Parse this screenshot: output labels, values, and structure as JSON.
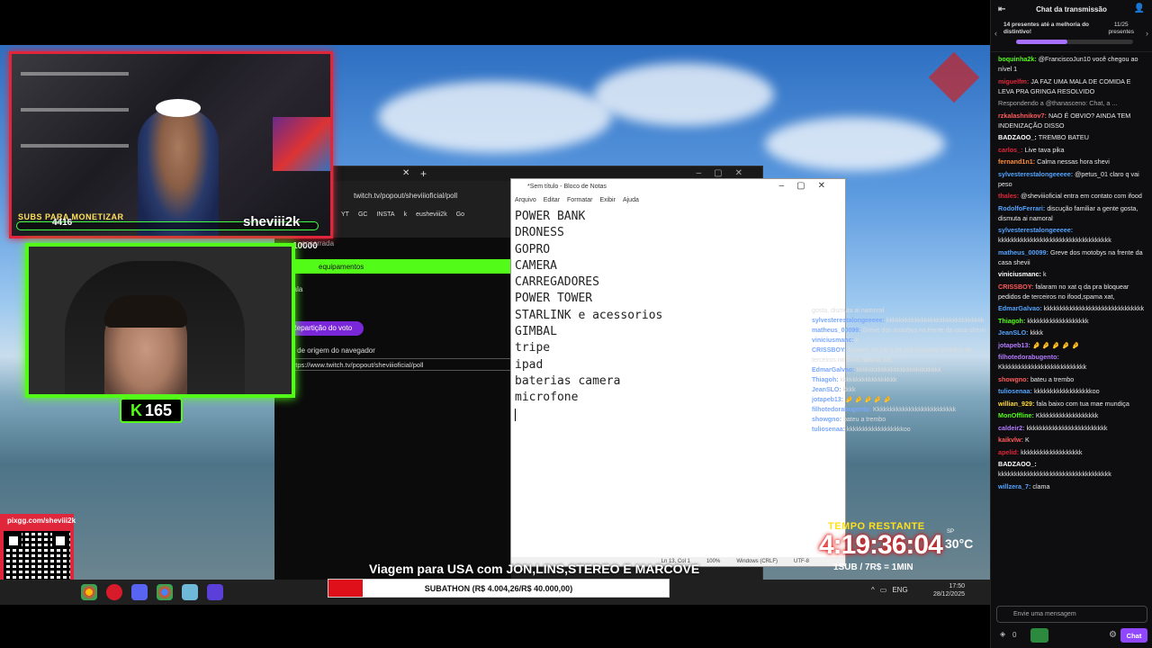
{
  "webcam_overlay": {
    "subs_label": "SUBS PARA MONETIZAR",
    "subs_count": "4416",
    "brand": "sheviii2k",
    "kick_followers": "165"
  },
  "browser": {
    "url": "twitch.tv/popout/sheviiioficial/poll",
    "bookmarks": [
      "YT",
      "GC",
      "INSTA",
      "k",
      "eusheviii2k",
      "Go"
    ],
    "poll_total": "10000",
    "poll_sub": "encerrada",
    "poll_option": "equipamentos",
    "poll_option2": "mala",
    "poll_button": "Repartição do voto",
    "origin_label": "RL de origem do navegador",
    "origin_url": "https://www.twitch.tv/popout/sheviiioficial/poll"
  },
  "notepad": {
    "title": "*Sem título - Bloco de Notas",
    "menu": [
      "Arquivo",
      "Editar",
      "Formatar",
      "Exibir",
      "Ajuda"
    ],
    "lines": [
      "POWER BANK",
      "DRONESS",
      "GOPRO",
      "CAMERA",
      "CARREGADORES",
      "POWER TOWER",
      "STARLINK e acessorios",
      "GIMBAL",
      "tripe",
      "ipad",
      "baterias camera",
      "microfone"
    ],
    "status_pos": "Ln 13, Col 1",
    "status_zoom": "100%",
    "status_eol": "Windows (CRLF)",
    "status_enc": "UTF-8"
  },
  "overlay_chat": [
    {
      "user": "",
      "text": "gosta, dismuta ai namoral"
    },
    {
      "user": "sylvesterestalongeeeee",
      "text": "kkkkkkkkkkkkkkkkkkkkkkkkkkkkkkk"
    },
    {
      "user": "matheus_00099",
      "text": "Greve dos motobys na frente da casa shevii"
    },
    {
      "user": "viniciusmanc",
      "text": "k"
    },
    {
      "user": "CRISSBOY",
      "text": "falaram no xat q da pra bloquear pedidos de terceiros no ifood,spama xat,"
    },
    {
      "user": "EdmarGalvao",
      "text": "kkkkkkkkkkkkkkkkkkkkkkkkkkk"
    },
    {
      "user": "Thiagoh",
      "text": "kkkkkkkkkkkkkkkkkk"
    },
    {
      "user": "JeanSLO",
      "text": "kkkk"
    },
    {
      "user": "jotapeb13",
      "text": "🤌 🤌 🤌 🤌 🤌"
    },
    {
      "user": "filhotedorabugento",
      "text": "Kkkkkkkkkkkkkkkkkkkkkkkkkk"
    },
    {
      "user": "showgno",
      "text": "bateu a trembo"
    },
    {
      "user": "tuliosenaa",
      "text": "kkkkkkkkkkkkkkkkkkoo"
    }
  ],
  "timer": {
    "label": "TEMPO RESTANTE",
    "value": "4:19:36:04",
    "note": "1SUB / 7R$ = 1MIN"
  },
  "weather": {
    "city": "SP",
    "temp": "30°C"
  },
  "qr": {
    "url": "pixgg.com/sheviii2k"
  },
  "caption": "Viagem para USA com JON,LINS,STEREO E MARCOVE",
  "subathon": {
    "text": "SUBATHON (R$ 4.004,26/R$ 40.000,00)",
    "progress": 0.1
  },
  "system_tray": {
    "lang": "ENG",
    "time": "17:50",
    "date": "28/12/2025"
  },
  "chat": {
    "header": "Chat da transmissão",
    "goal_text": "14 presentes até a melhoria do distintivo!",
    "goal_count": "11/25",
    "goal_unit": "presentes",
    "goal_progress": 0.44,
    "messages": [
      {
        "user": "boquinha2k",
        "color": "#53fc18",
        "text": "@FranciscoJun10 você chegou ao nível 1"
      },
      {
        "user": "miguelfm",
        "color": "#e0263a",
        "text": "JA FAZ UMA MALA DE COMIDA E LEVA PRA GRINGA RESOLVIDO"
      },
      {
        "user": "",
        "color": "#aaa",
        "text": "Respondendo a @thanasceno: Chat, a ..."
      },
      {
        "user": "rzkalashnikov7",
        "color": "#ff5b5b",
        "text": "NAO É OBVIO? AINDA TEM INDENIZAÇÃO DISSO"
      },
      {
        "user": "BADZAOO_",
        "color": "#ffffff",
        "text": "TREMBO BATEU"
      },
      {
        "user": "carlos_",
        "color": "#e0263a",
        "text": "Live tava pika"
      },
      {
        "user": "fernand1n1",
        "color": "#ff8c3a",
        "text": "Calma nessas hora shevi"
      },
      {
        "user": "sylvesterestalongeeeee",
        "color": "#53a4ff",
        "text": "@petus_01 claro q vai peso"
      },
      {
        "user": "thales",
        "color": "#e0263a",
        "text": "@sheviiioficial entra em contato com ifood"
      },
      {
        "user": "RodolfoFerrari",
        "color": "#53a4ff",
        "text": "discução familiar a gente gosta, dismuta ai namoral"
      },
      {
        "user": "sylvesterestalongeeeee",
        "color": "#53a4ff",
        "text": "kkkkkkkkkkkkkkkkkkkkkkkkkkkkkkkkkkk"
      },
      {
        "user": "matheus_00099",
        "color": "#53a4ff",
        "text": "Greve dos motobys na frente da casa shevii"
      },
      {
        "user": "viniciusmanc",
        "color": "#ffffff",
        "text": "k"
      },
      {
        "user": "CRISSBOY",
        "color": "#ff5b5b",
        "text": "falaram no xat q da pra bloquear pedidos de terceiros no ifood,spama xat,"
      },
      {
        "user": "EdmarGalvao",
        "color": "#53a4ff",
        "text": "kkkkkkkkkkkkkkkkkkkkkkkkkkkkkkk"
      },
      {
        "user": "Thiagoh",
        "color": "#53fc18",
        "text": "kkkkkkkkkkkkkkkkkkk"
      },
      {
        "user": "JeanSLO",
        "color": "#53a4ff",
        "text": "kkkk"
      },
      {
        "user": "jotapeb13",
        "color": "#b47aff",
        "text": "🤌 🤌 🤌 🤌 🤌"
      },
      {
        "user": "filhotedorabugento",
        "color": "#b47aff",
        "text": "Kkkkkkkkkkkkkkkkkkkkkkkkkkk"
      },
      {
        "user": "showgno",
        "color": "#ff5b5b",
        "text": "bateu a trembo"
      },
      {
        "user": "tuliosenaa",
        "color": "#53a4ff",
        "text": "kkkkkkkkkkkkkkkkkkoo"
      },
      {
        "user": "willian_929",
        "color": "#ffd93a",
        "text": "fala baixo com tua mae mundiça"
      },
      {
        "user": "MonOffline",
        "color": "#53fc18",
        "text": "Kkkkkkkkkkkkkkkkkkk"
      },
      {
        "user": "caldeir2",
        "color": "#b47aff",
        "text": "kkkkkkkkkkkkkkkkkkkkkkkkk"
      },
      {
        "user": "kaikvlw",
        "color": "#ff5b5b",
        "text": "K"
      },
      {
        "user": "apelid",
        "color": "#e0263a",
        "text": "kkkkkkkkkkkkkkkkkkk"
      },
      {
        "user": "BADZAOO_",
        "color": "#ffffff",
        "text": "kkkkkkkkkkkkkkkkkkkkkkkkkkkkkkkkkkk"
      },
      {
        "user": "willzera_7",
        "color": "#53a4ff",
        "text": "clama"
      }
    ],
    "input_placeholder": "Envie uma mensagem",
    "points": "0",
    "send_label": "Chat"
  },
  "colors": {
    "kick_green": "#53fc18",
    "twitch_purple": "#9147ff",
    "frame_red": "#e0263a"
  }
}
